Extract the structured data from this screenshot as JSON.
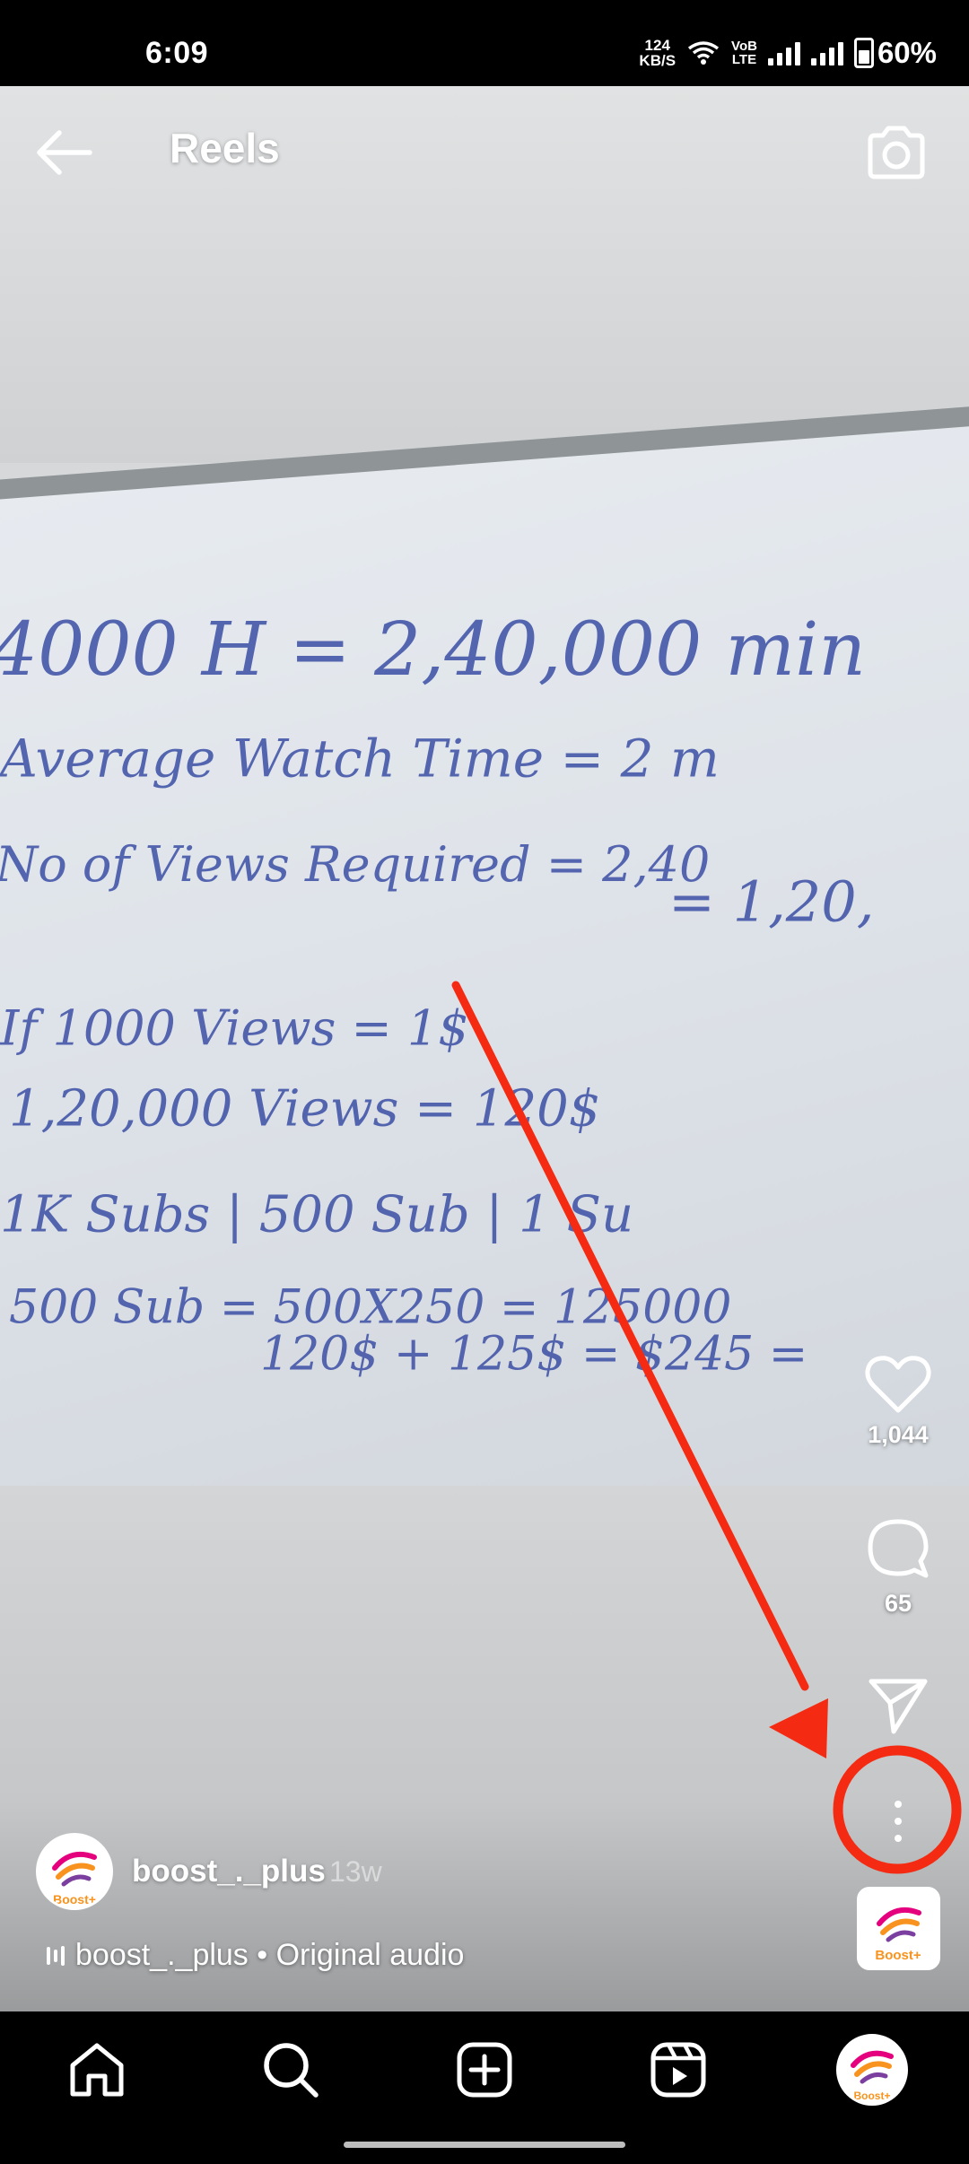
{
  "status_bar": {
    "time": "6:09",
    "net_speed_value": "124",
    "net_speed_unit": "KB/S",
    "volte_top": "VoB",
    "volte_bottom": "LTE",
    "battery": "60%"
  },
  "header": {
    "title": "Reels",
    "back_icon": "arrow-left-icon",
    "camera_icon": "camera-icon"
  },
  "video": {
    "board_lines": [
      "4000 H = 2,40,000 min",
      "Average Watch Time = 2 m",
      "No of Views Required = 2,40",
      "= 1,20,",
      "If 1000 Views = 1$",
      "1,20,000 Views = 120$",
      "1K Subs | 500 Sub | 1 Su",
      "500 Sub = 500X250 = 125000",
      "120$ + 125$ = $245 ="
    ]
  },
  "actions": {
    "like_count": "1,044",
    "comment_count": "65",
    "like_icon": "heart-icon",
    "comment_icon": "comment-icon",
    "share_icon": "send-icon",
    "more_icon": "more-vertical-icon"
  },
  "post": {
    "username": "boost_._plus",
    "age": "13w",
    "audio_label": "boost_._plus • Original audio",
    "avatar_text": "Boost+"
  },
  "annotation": {
    "color": "#f42b12"
  },
  "nav": {
    "items": [
      "home-icon",
      "search-icon",
      "create-icon",
      "reels-icon",
      "profile-avatar"
    ]
  },
  "brand": {
    "logo_text": "Boost+",
    "logo_colors": [
      "#e5007d",
      "#f7931e",
      "#7b3fa0"
    ]
  }
}
